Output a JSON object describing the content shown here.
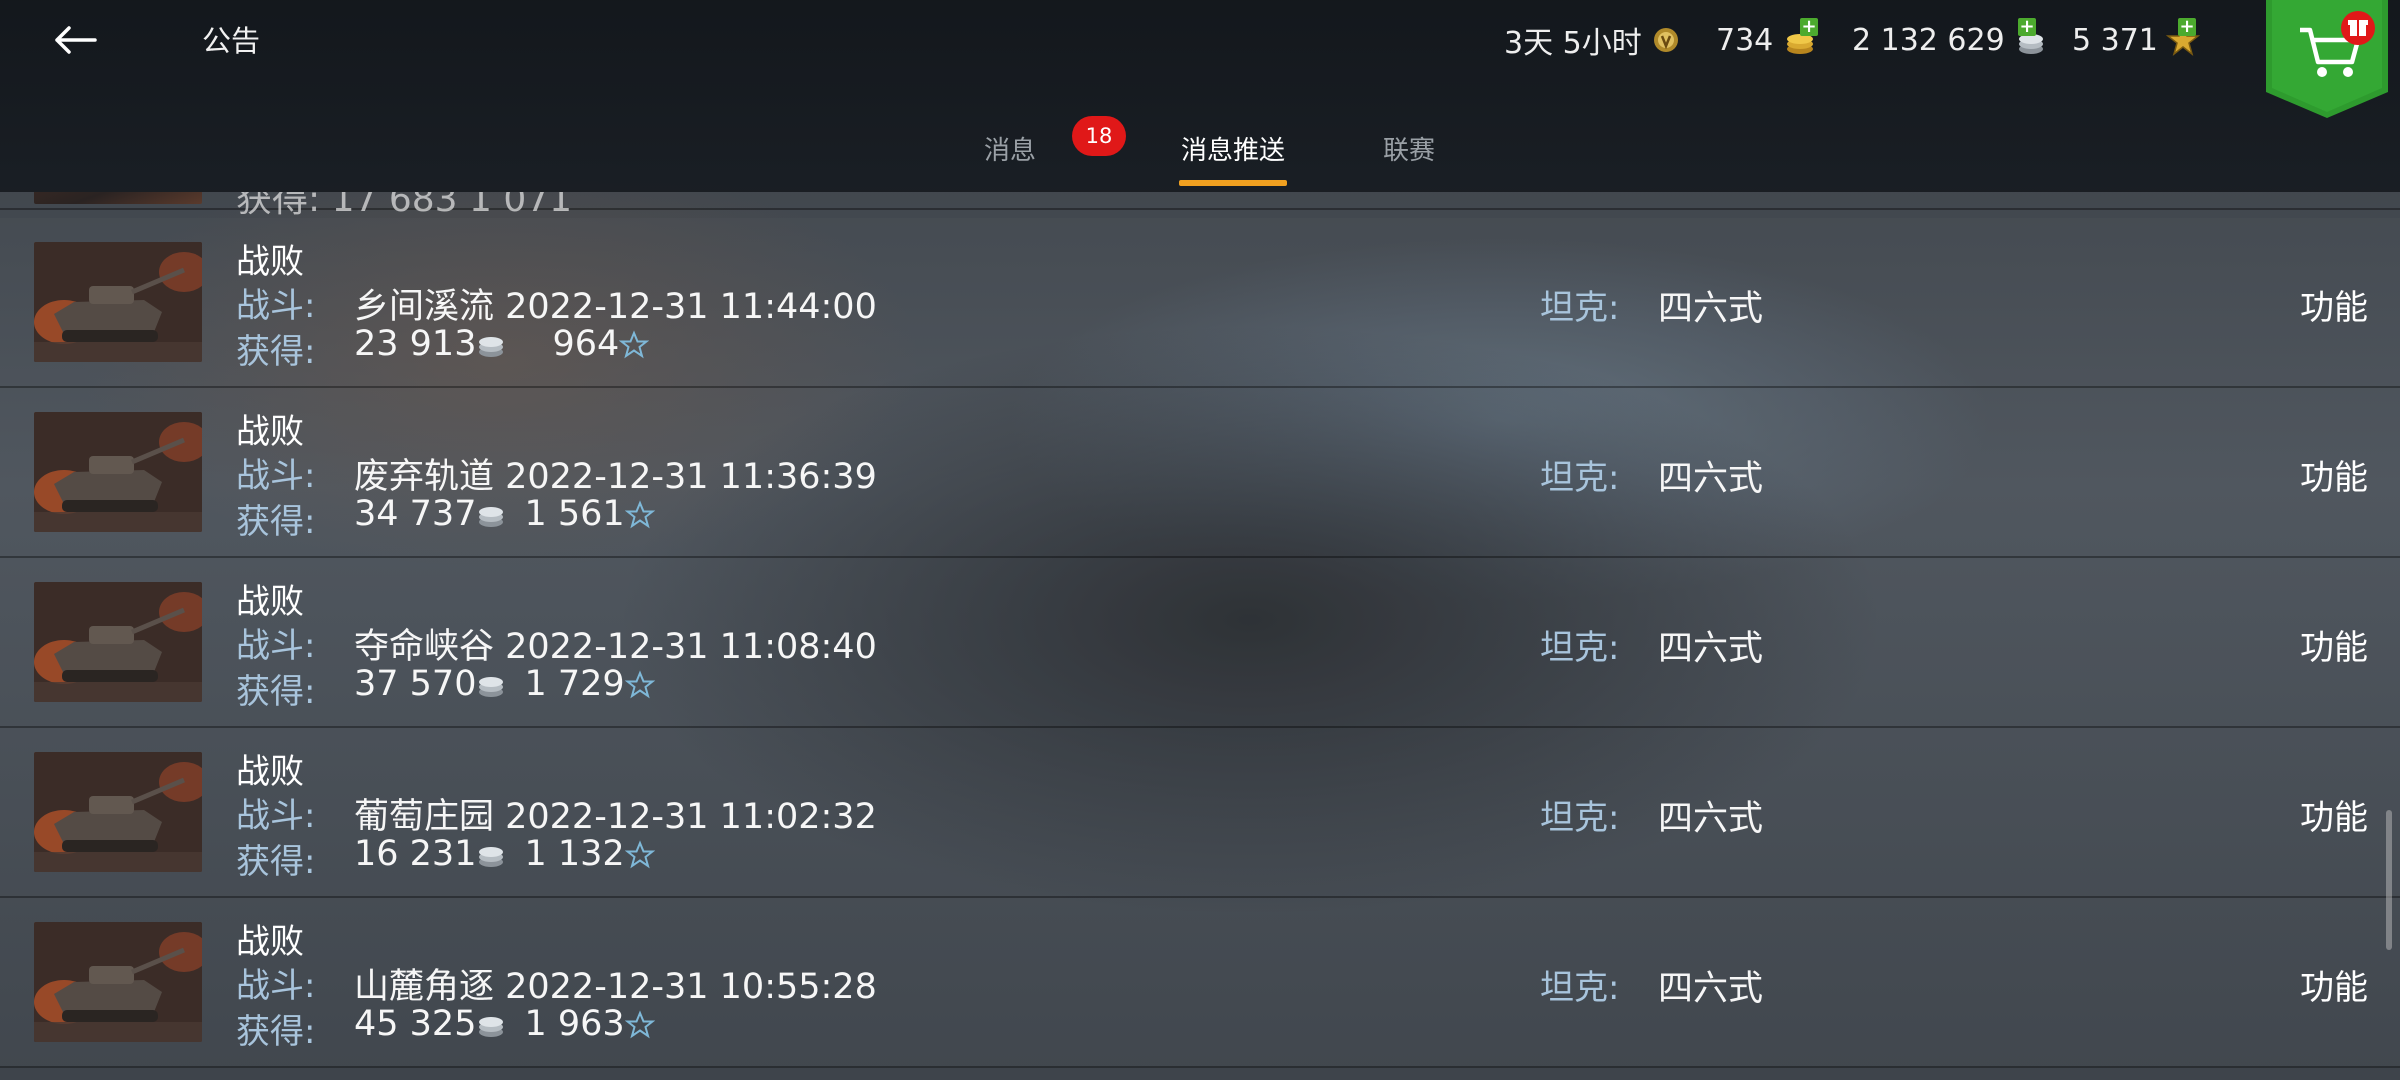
{
  "header": {
    "title": "公告",
    "premium_time": "3天 5小时",
    "gold": "734",
    "silver": "2 132 629",
    "free_xp": "5 371"
  },
  "tabs": [
    {
      "label": "消息",
      "badge": "18"
    },
    {
      "label": "消息推送",
      "active": true
    },
    {
      "label": "联赛"
    }
  ],
  "labels": {
    "battle": "战斗:",
    "earned": "获得:",
    "tank": "坦克:",
    "function": "功能"
  },
  "partial_row": {
    "text": "获得: 17 683 1 071"
  },
  "rows": [
    {
      "result": "战败",
      "map": "乡间溪流",
      "datetime": "2022-12-31 11:44:00",
      "credits": "23 913",
      "xp": "964",
      "tank": "四六式"
    },
    {
      "result": "战败",
      "map": "废弃轨道",
      "datetime": "2022-12-31 11:36:39",
      "credits": "34 737",
      "xp": "1 561",
      "tank": "四六式"
    },
    {
      "result": "战败",
      "map": "夺命峡谷",
      "datetime": "2022-12-31 11:08:40",
      "credits": "37 570",
      "xp": "1 729",
      "tank": "四六式"
    },
    {
      "result": "战败",
      "map": "葡萄庄园",
      "datetime": "2022-12-31 11:02:32",
      "credits": "16 231",
      "xp": "1 132",
      "tank": "四六式"
    },
    {
      "result": "战败",
      "map": "山麓角逐",
      "datetime": "2022-12-31 10:55:28",
      "credits": "45 325",
      "xp": "1 963",
      "tank": "四六式"
    }
  ],
  "colors": {
    "accent_underline": "#f0a020",
    "badge": "#e01818",
    "label_blue": "#a8c4dc",
    "shop_green": "#2e9b2e"
  }
}
